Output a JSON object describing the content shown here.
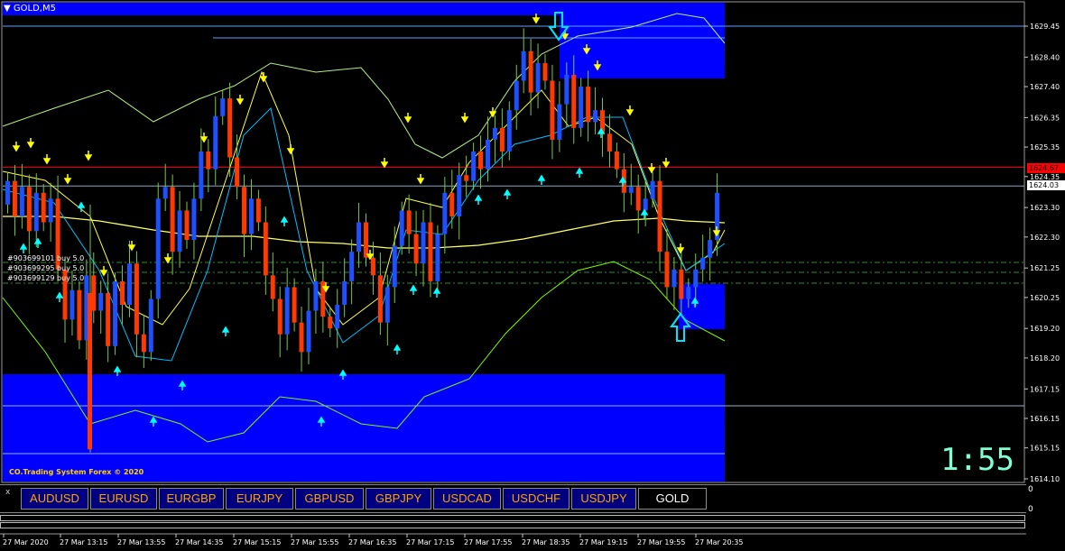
{
  "window": {
    "title": "GOLD,M5",
    "menu_icon": "triangle-down-icon"
  },
  "price_axis": {
    "ticks": [
      "1629.45",
      "1628.40",
      "1627.40",
      "1626.35",
      "1625.35",
      "1624.35",
      "1623.30",
      "1622.30",
      "1621.25",
      "1620.25",
      "1619.20",
      "1618.20",
      "1617.15",
      "1616.15",
      "1615.15",
      "1614.10"
    ],
    "current_bid": "1624.03",
    "red_level": "1624.67"
  },
  "time_axis": {
    "labels": [
      "27 Mar 2020",
      "27 Mar 13:15",
      "27 Mar 13:55",
      "27 Mar 14:35",
      "27 Mar 15:15",
      "27 Mar 15:55",
      "27 Mar 16:35",
      "27 Mar 17:15",
      "27 Mar 17:55",
      "27 Mar 18:35",
      "27 Mar 19:15",
      "27 Mar 19:55",
      "27 Mar 20:35"
    ]
  },
  "orders": [
    "#903699101 buy 5.0",
    "#903699295 buy 5.0",
    "#903699129 buy 5.0"
  ],
  "watermark": "CO.Trading System Forex © 2020",
  "countdown": "1:55",
  "symbols": [
    "AUDUSD",
    "EURUSD",
    "EURGBP",
    "EURJPY",
    "GBPUSD",
    "GBPJPY",
    "USDCAD",
    "USDCHF",
    "USDJPY",
    "GOLD"
  ],
  "active_symbol": "GOLD",
  "close_label": "x",
  "panel_zero_top": "0",
  "panel_zero_bottom": "0",
  "colors": {
    "background": "#000000",
    "zone": "#0000ff",
    "bull": "#1e50ff",
    "bear": "#ff3a00",
    "down_arrow": "#ffff00",
    "up_arrow": "#00ffff",
    "red_line": "#ff0000",
    "envelope": "#7cfc00",
    "ma_yellow": "#ffff66"
  }
}
